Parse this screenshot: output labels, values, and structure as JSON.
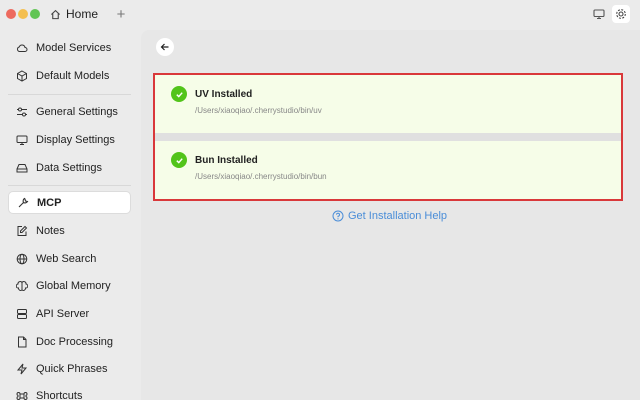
{
  "titlebar": {
    "tab_label": "Home",
    "new_tab_glyph": "+"
  },
  "sidebar": {
    "items": [
      {
        "label": "Model Services",
        "icon": "cloud-icon"
      },
      {
        "label": "Default Models",
        "icon": "cube-icon"
      },
      {
        "label": "General Settings",
        "icon": "sliders-icon"
      },
      {
        "label": "Display Settings",
        "icon": "monitor-icon"
      },
      {
        "label": "Data Settings",
        "icon": "hard-drive-icon"
      },
      {
        "label": "MCP",
        "icon": "wrench-icon",
        "active": true
      },
      {
        "label": "Notes",
        "icon": "note-edit-icon"
      },
      {
        "label": "Web Search",
        "icon": "globe-icon"
      },
      {
        "label": "Global Memory",
        "icon": "brain-icon"
      },
      {
        "label": "API Server",
        "icon": "server-icon"
      },
      {
        "label": "Doc Processing",
        "icon": "file-icon"
      },
      {
        "label": "Quick Phrases",
        "icon": "zap-icon"
      },
      {
        "label": "Shortcuts",
        "icon": "command-icon"
      }
    ]
  },
  "main": {
    "cards": [
      {
        "title": "UV Installed",
        "path": "/Users/xiaoqiao/.cherrystudio/bin/uv"
      },
      {
        "title": "Bun Installed",
        "path": "/Users/xiaoqiao/.cherrystudio/bin/bun"
      }
    ],
    "help_link": "Get Installation Help"
  },
  "colors": {
    "accent_link": "#4a8dd8",
    "success": "#52c41a",
    "highlight_border": "#d9383a",
    "card_bg": "#f6fde8"
  }
}
